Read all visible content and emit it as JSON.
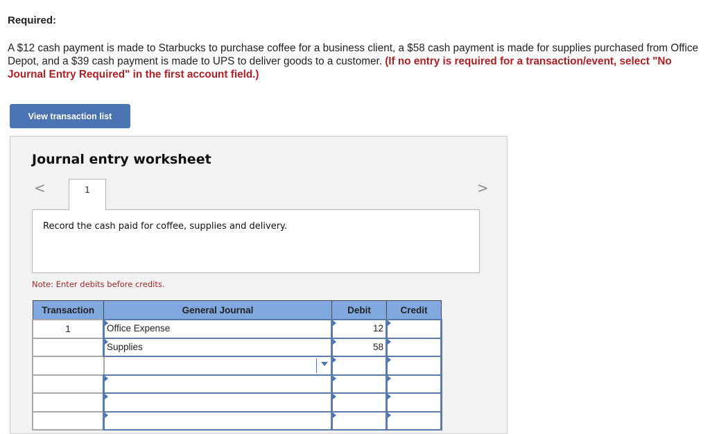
{
  "required_label": "Required:",
  "problem": {
    "text": "A $12 cash payment is made to Starbucks to purchase coffee for a business client, a $58 cash payment is made for supplies purchased from Office Depot, and a $39 cash payment is made to UPS to deliver goods to a customer. ",
    "instruction": "(If no entry is required for a transaction/event, select \"No Journal Entry Required\" in the first account field.)"
  },
  "view_transaction_button": "View transaction list",
  "worksheet": {
    "title": "Journal entry worksheet",
    "prev_icon": "chevron-left-icon",
    "next_icon": "chevron-right-icon",
    "prev_glyph": "<",
    "next_glyph": ">",
    "tabs": [
      {
        "label": "1"
      }
    ],
    "description": "Record the cash paid for coffee, supplies and delivery.",
    "note": "Note: Enter debits before credits.",
    "table": {
      "headers": [
        "Transaction",
        "General Journal",
        "Debit",
        "Credit"
      ],
      "rows": [
        {
          "transaction": "1",
          "account": "Office Expense",
          "debit": "12",
          "credit": ""
        },
        {
          "transaction": "",
          "account": "Supplies",
          "debit": "58",
          "credit": ""
        },
        {
          "transaction": "",
          "account": "",
          "debit": "",
          "credit": ""
        },
        {
          "transaction": "",
          "account": "",
          "debit": "",
          "credit": ""
        },
        {
          "transaction": "",
          "account": "",
          "debit": "",
          "credit": ""
        },
        {
          "transaction": "",
          "account": "",
          "debit": "",
          "credit": ""
        }
      ]
    }
  },
  "colors": {
    "accent": "#4a74b4",
    "header_bg": "#82a9df",
    "instruction_red": "#b01f24",
    "note_red": "#a0282a",
    "panel_bg": "#f2f2f2"
  }
}
